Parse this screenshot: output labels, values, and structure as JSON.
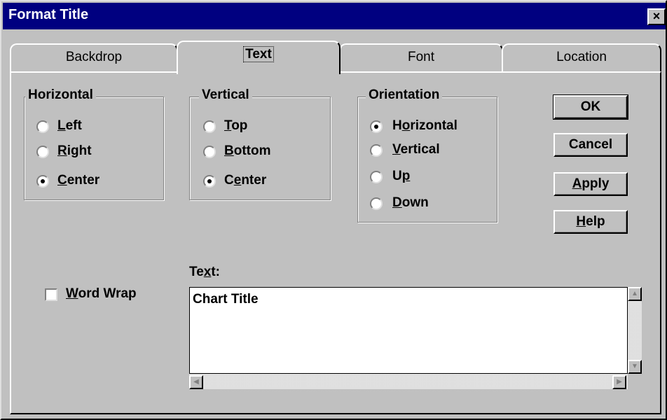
{
  "window": {
    "title": "Format Title",
    "close_glyph": "×"
  },
  "tabs": [
    {
      "label": "Backdrop"
    },
    {
      "label": "Text",
      "selected": true
    },
    {
      "label": "Font"
    },
    {
      "label": "Location"
    }
  ],
  "horizontal": {
    "label": "Horizontal",
    "options": [
      {
        "pre": "",
        "key": "L",
        "post": "eft",
        "selected": false
      },
      {
        "pre": "",
        "key": "R",
        "post": "ight",
        "selected": false
      },
      {
        "pre": "",
        "key": "C",
        "post": "enter",
        "selected": true
      }
    ]
  },
  "vertical": {
    "label": "Vertical",
    "options": [
      {
        "pre": "",
        "key": "T",
        "post": "op",
        "selected": false
      },
      {
        "pre": "",
        "key": "B",
        "post": "ottom",
        "selected": false
      },
      {
        "pre": "C",
        "key": "e",
        "post": "nter",
        "selected": true
      }
    ]
  },
  "orientation": {
    "label": "Orientation",
    "options": [
      {
        "pre": "H",
        "key": "o",
        "post": "rizontal",
        "selected": true
      },
      {
        "pre": "",
        "key": "V",
        "post": "ertical",
        "selected": false
      },
      {
        "pre": "U",
        "key": "p",
        "post": "",
        "selected": false
      },
      {
        "pre": "",
        "key": "D",
        "post": "own",
        "selected": false
      }
    ]
  },
  "buttons": {
    "ok": "OK",
    "cancel": "Cancel",
    "apply": {
      "key": "A",
      "post": "pply"
    },
    "help": {
      "key": "H",
      "post": "elp"
    }
  },
  "word_wrap": {
    "key": "W",
    "post": "ord Wrap",
    "checked": false
  },
  "text_field": {
    "label_pre": "Te",
    "label_key": "x",
    "label_post": "t:",
    "value": "Chart Title"
  },
  "icons": [
    "close-icon",
    "scroll-up-arrow-icon",
    "scroll-down-arrow-icon",
    "scroll-left-arrow-icon",
    "scroll-right-arrow-icon"
  ],
  "colors": {
    "titlebar": "#000080",
    "face": "#c0c0c0",
    "title_text": "#ffffff"
  }
}
